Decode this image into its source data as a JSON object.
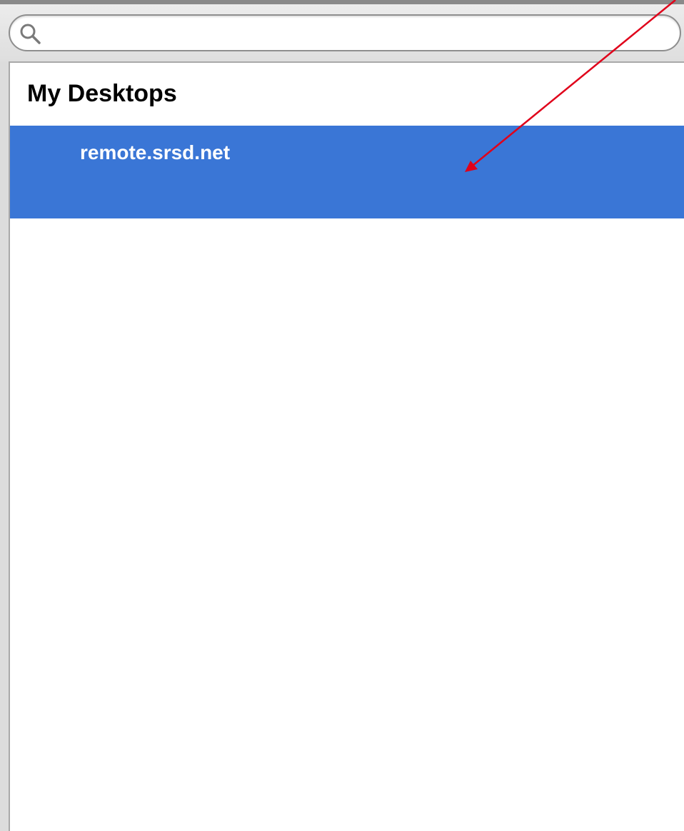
{
  "search": {
    "placeholder": "",
    "value": ""
  },
  "desktops": {
    "section_title": "My Desktops",
    "items": [
      {
        "label": "remote.srsd.net",
        "selected": true
      }
    ]
  },
  "colors": {
    "selection": "#3a76d6",
    "annotation_arrow": "#e0001a"
  },
  "icons": {
    "search": "magnifier-icon"
  }
}
